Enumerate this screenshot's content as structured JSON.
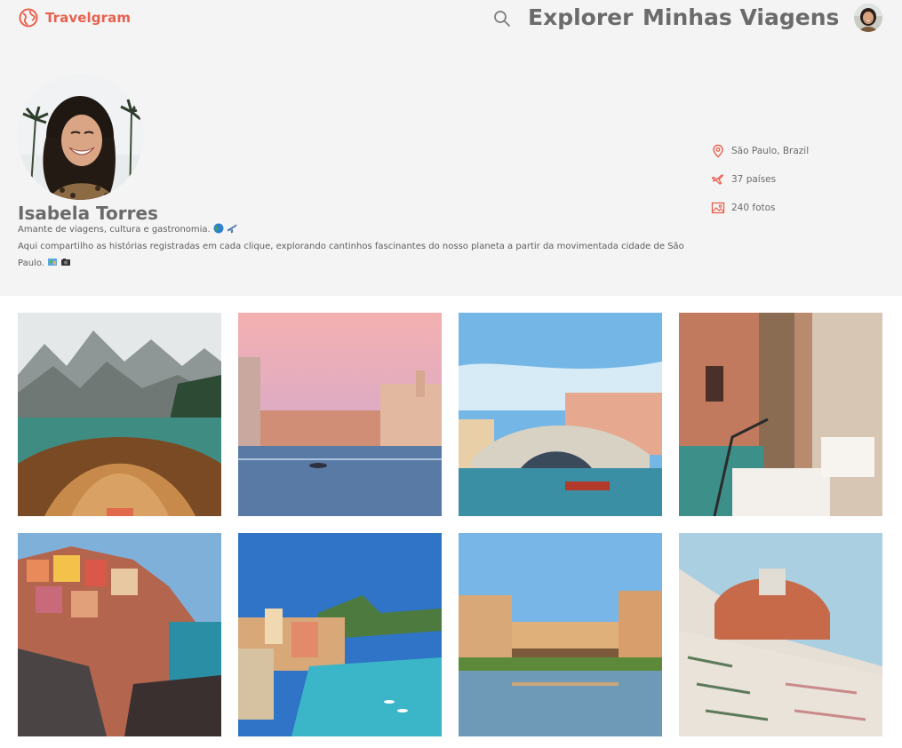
{
  "header": {
    "brand": "Travelgram",
    "nav": [
      {
        "label": "Explorer"
      },
      {
        "label": "Minhas Viagens"
      }
    ]
  },
  "profile": {
    "name": "Isabela Torres",
    "bio_line1": "Amante de viagens, cultura e gastronomia.",
    "bio_line2": "Aqui compartilho as histórias registradas em cada clique, explorando cantinhos fascinantes do nosso planeta a partir da movimentada cidade de São Paulo.",
    "stats": [
      {
        "icon": "location-pin-icon",
        "text": "São Paulo, Brazil"
      },
      {
        "icon": "airplane-icon",
        "text": "37 países"
      },
      {
        "icon": "image-icon",
        "text": "240 fotos"
      }
    ]
  },
  "gallery": [
    {
      "subject": "boat-lake-mountains"
    },
    {
      "subject": "venice-canal-sunset"
    },
    {
      "subject": "rialto-bridge"
    },
    {
      "subject": "venice-restaurant-canal"
    },
    {
      "subject": "manarola-cliff-village"
    },
    {
      "subject": "vernazza-harbor"
    },
    {
      "subject": "ponte-vecchio"
    },
    {
      "subject": "florence-duomo"
    }
  ],
  "colors": {
    "accent": "#e8614f",
    "text": "#6b6b6b",
    "panel": "#f4f4f4"
  }
}
